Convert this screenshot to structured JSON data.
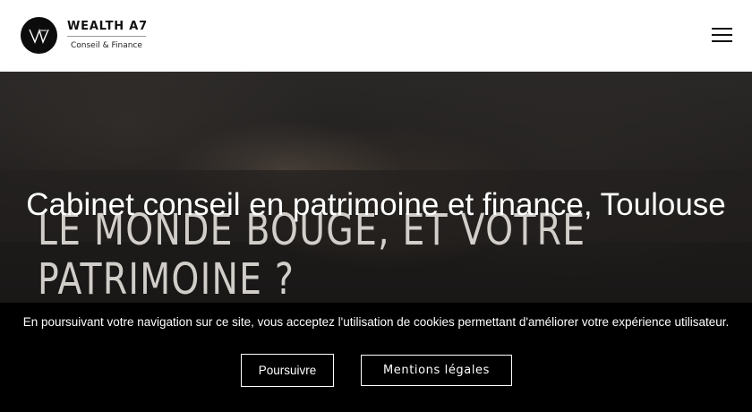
{
  "header": {
    "brand_name": "WEALTH A7",
    "brand_tagline": "Conseil & Finance",
    "menu_icon": "hamburger-menu-icon"
  },
  "hero": {
    "heading_line1": "LE MONDE BOUGE, ET VOTRE",
    "heading_line2": "PATRIMOINE ?",
    "subtitle": "Cabinet conseil en patrimoine et finance, Toulouse"
  },
  "cookie_banner": {
    "message": "En poursuivant votre navigation sur ce site, vous acceptez l'utilisation de cookies permettant d'améliorer votre expérience utilisateur.",
    "accept_label": "Poursuivre",
    "legal_label": "Mentions légales"
  },
  "colors": {
    "header_bg": "#ffffff",
    "logo_mark": "#0c0c0c",
    "cookie_bg": "#000000",
    "text_light": "#ffffff"
  }
}
